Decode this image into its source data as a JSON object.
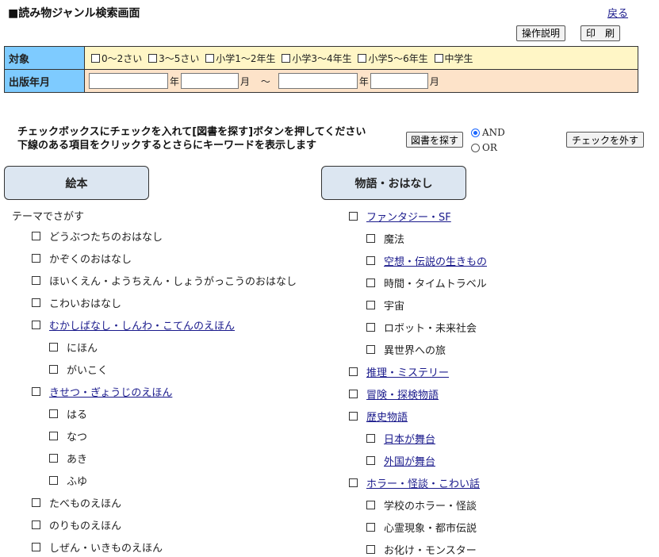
{
  "header": {
    "title": "■読み物ジャンル検索画面",
    "back_label": "戻る"
  },
  "toolbar": {
    "help_label": "操作説明",
    "print_label": "印　刷"
  },
  "filters": {
    "target_label": "対象",
    "targets": [
      "0～2さい",
      "3～5さい",
      "小学1～2年生",
      "小学3～4年生",
      "小学5～6年生",
      "中学生"
    ],
    "date_label": "出版年月",
    "year_unit": "年",
    "month_unit": "月",
    "range_sep": "～"
  },
  "instructions": {
    "line1": "チェックボックスにチェックを入れて[図書を探す]ボタンを押してください",
    "line2": "下線のある項目をクリックするとさらにキーワードを表示します"
  },
  "search": {
    "button_label": "図書を探す",
    "and_label": "AND",
    "or_label": "OR",
    "clear_label": "チェックを外す"
  },
  "left": {
    "heading": "絵本",
    "sub_label": "テーマでさがす",
    "items": [
      {
        "label": "どうぶつたちのおはなし",
        "indent": 0,
        "link": false
      },
      {
        "label": "かぞくのおはなし",
        "indent": 0,
        "link": false
      },
      {
        "label": "ほいくえん・ようちえん・しょうがっこうのおはなし",
        "indent": 0,
        "link": false
      },
      {
        "label": "こわいおはなし",
        "indent": 0,
        "link": false
      },
      {
        "label": "むかしばなし・しんわ・こてんのえほん",
        "indent": 0,
        "link": true
      },
      {
        "label": "にほん",
        "indent": 1,
        "link": false
      },
      {
        "label": "がいこく",
        "indent": 1,
        "link": false
      },
      {
        "label": "きせつ・ぎょうじのえほん",
        "indent": 0,
        "link": true
      },
      {
        "label": "はる",
        "indent": 1,
        "link": false
      },
      {
        "label": "なつ",
        "indent": 1,
        "link": false
      },
      {
        "label": "あき",
        "indent": 1,
        "link": false
      },
      {
        "label": "ふゆ",
        "indent": 1,
        "link": false
      },
      {
        "label": "たべものえほん",
        "indent": 0,
        "link": false
      },
      {
        "label": "のりものえほん",
        "indent": 0,
        "link": false
      },
      {
        "label": "しぜん・いきものえほん",
        "indent": 0,
        "link": false
      }
    ]
  },
  "right": {
    "heading": "物語・おはなし",
    "items": [
      {
        "label": "ファンタジー・SF",
        "indent": 0,
        "link": true
      },
      {
        "label": "魔法",
        "indent": 1,
        "link": false
      },
      {
        "label": "空想・伝説の生きもの",
        "indent": 1,
        "link": true
      },
      {
        "label": "時間・タイムトラベル",
        "indent": 1,
        "link": false
      },
      {
        "label": "宇宙",
        "indent": 1,
        "link": false
      },
      {
        "label": "ロボット・未来社会",
        "indent": 1,
        "link": false
      },
      {
        "label": "異世界への旅",
        "indent": 1,
        "link": false
      },
      {
        "label": "推理・ミステリー",
        "indent": 0,
        "link": true
      },
      {
        "label": "冒険・探検物語",
        "indent": 0,
        "link": true
      },
      {
        "label": "歴史物語",
        "indent": 0,
        "link": true
      },
      {
        "label": "日本が舞台",
        "indent": 1,
        "link": true
      },
      {
        "label": "外国が舞台",
        "indent": 1,
        "link": true
      },
      {
        "label": "ホラー・怪談・こわい話",
        "indent": 0,
        "link": true
      },
      {
        "label": "学校のホラー・怪談",
        "indent": 1,
        "link": false
      },
      {
        "label": "心霊現象・都市伝説",
        "indent": 1,
        "link": false
      },
      {
        "label": "お化け・モンスター",
        "indent": 1,
        "link": false
      }
    ]
  }
}
